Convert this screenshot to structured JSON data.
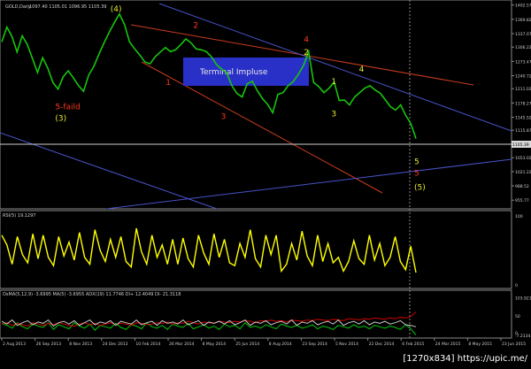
{
  "header": {
    "symbol_label": "GOLD,Daily",
    "ohlc": "1097.40 1105.01 1096.95 1105.39"
  },
  "watermark": "[1270x834] https://upic.me/",
  "chart_data": [
    {
      "type": "line",
      "title": "GOLD,Daily",
      "x": [
        "2 Aug 2013",
        "26 Sep 2013",
        "8 Nov 2013",
        "24 Dec 2013",
        "10 Feb 2014",
        "26 Mar 2014",
        "8 May 2014",
        "25 Jun 2014",
        "8 Aug 2014",
        "23 Sep 2014",
        "5 Nov 2014",
        "22 Dec 2014",
        "6 Feb 2015",
        "24 Mar 2015",
        "8 May 2015",
        "23 Jun 2015"
      ],
      "yticks": [
        1402.57,
        1369.82,
        1337.07,
        1306.22,
        1273.47,
        1240.72,
        1211.02,
        1178.27,
        1145.52,
        1115.87,
        1083.12,
        1053.02,
        1021.22,
        988.52,
        955.77
      ],
      "ylim": [
        940,
        1410
      ],
      "current_price": 1105.39,
      "current_price_label": "1105.39",
      "series": [
        {
          "color": "#16c60c",
          "values": [
            1318,
            1352,
            1330,
            1295,
            1332,
            1312,
            1280,
            1248,
            1282,
            1258,
            1225,
            1210,
            1238,
            1252,
            1236,
            1218,
            1205,
            1242,
            1262,
            1290,
            1316,
            1340,
            1362,
            1382,
            1358,
            1318,
            1302,
            1288,
            1272,
            1268,
            1284,
            1295,
            1305,
            1296,
            1300,
            1312,
            1325,
            1316,
            1302,
            1300,
            1296,
            1284,
            1266,
            1256,
            1247,
            1218,
            1200,
            1192,
            1222,
            1228,
            1206,
            1188,
            1175,
            1156,
            1198,
            1202,
            1218,
            1227,
            1244,
            1264,
            1296,
            1225,
            1216,
            1202,
            1212,
            1226,
            1184,
            1185,
            1174,
            1192,
            1202,
            1212,
            1218,
            1208,
            1201,
            1186,
            1170,
            1162,
            1174,
            1150,
            1131,
            1097
          ]
        }
      ],
      "wave_labels": [
        {
          "text": "(4)",
          "x": "10 Feb 2014",
          "y": 1388,
          "color": "#e8e830"
        },
        {
          "text": "2",
          "x": "25 Jun 2014",
          "y": 1350,
          "color": "#ff3a1a"
        },
        {
          "text": "4",
          "x": "22 Dec 2014",
          "y": 1318,
          "color": "#ff3a1a"
        },
        {
          "text": "2",
          "x": "22 Dec 2014",
          "y": 1288,
          "color": "#e8e830"
        },
        {
          "text": "1",
          "x": "8 May 2014",
          "y": 1220,
          "color": "#ff3a1a"
        },
        {
          "text": "1",
          "x": "6 Feb 2015",
          "y": 1222,
          "color": "#e8e830"
        },
        {
          "text": "4",
          "x": "24 Mar 2015",
          "y": 1250,
          "color": "#e8e830"
        },
        {
          "text": "3",
          "x": "8 Aug 2014",
          "y": 1142,
          "color": "#ff3a1a"
        },
        {
          "text": "3",
          "x": "6 Feb 2015",
          "y": 1148,
          "color": "#e8e830"
        },
        {
          "text": "5-faild",
          "x": "8 Nov 2013",
          "y": 1164,
          "color": "#ff3a1a"
        },
        {
          "text": "(3)",
          "x": "8 Nov 2013",
          "y": 1138,
          "color": "#e8e830"
        },
        {
          "text": "5",
          "x": "23 Jun 2015",
          "y": 1038,
          "color": "#e8e830"
        },
        {
          "text": "5",
          "x": "23 Jun 2015",
          "y": 1012,
          "color": "#ff3a1a"
        },
        {
          "text": "(5)",
          "x": "23 Jun 2015",
          "y": 980,
          "color": "#e8e830"
        }
      ],
      "annotation": {
        "text": "Terminal Impluse",
        "color": "#2930c8"
      }
    },
    {
      "type": "line",
      "title": "RSI(5) 19.1297",
      "ylim": [
        0,
        100
      ],
      "yticks": [
        100,
        0
      ],
      "series": [
        {
          "color": "#ffff00",
          "values": [
            72,
            58,
            30,
            70,
            44,
            32,
            74,
            38,
            72,
            40,
            28,
            70,
            42,
            62,
            36,
            76,
            40,
            30,
            80,
            50,
            34,
            66,
            40,
            70,
            34,
            26,
            82,
            48,
            30,
            72,
            40,
            58,
            30,
            66,
            30,
            68,
            38,
            26,
            72,
            46,
            30,
            74,
            40,
            66,
            32,
            28,
            60,
            40,
            80,
            38,
            26,
            72,
            44,
            72,
            20,
            30,
            60,
            36,
            78,
            42,
            28,
            72,
            34,
            60,
            32,
            40,
            20,
            34,
            64,
            38,
            30,
            72,
            36,
            60,
            28,
            40,
            70,
            34,
            22,
            56,
            18
          ]
        }
      ]
    },
    {
      "type": "line",
      "title": "OsMA(5,12,9) -3.6995 MA(5) -3.6955 ADX(19) 11.7746 DI+ 12.4049 DI- 21.3118",
      "ylim": [
        -10,
        110
      ],
      "yticks": [
        103.9213,
        50,
        0,
        -7.2134
      ],
      "series": [
        {
          "color": "#00c800",
          "values": [
            28,
            22,
            14,
            30,
            18,
            12,
            26,
            20,
            16,
            30,
            10,
            24,
            18,
            12,
            30,
            20,
            14,
            26,
            8,
            22,
            18,
            14,
            28,
            16,
            10,
            24,
            20,
            12,
            30,
            18,
            14,
            22,
            10,
            26,
            20,
            16,
            28,
            12,
            18,
            24,
            14,
            20,
            10,
            26,
            18,
            22,
            12,
            30,
            16,
            20,
            14,
            24,
            18,
            12,
            26,
            20,
            16,
            22,
            14,
            18,
            24,
            12,
            20,
            16,
            10,
            22,
            18,
            14,
            24,
            16,
            20,
            12,
            22,
            18,
            14,
            20,
            16,
            10,
            24,
            12,
            -6
          ]
        },
        {
          "color": "#d40000",
          "values": [
            26,
            30,
            22,
            28,
            24,
            20,
            30,
            26,
            22,
            28,
            24,
            30,
            26,
            22,
            20,
            26,
            30,
            24,
            28,
            22,
            26,
            30,
            24,
            28,
            26,
            22,
            30,
            28,
            24,
            26,
            30,
            28,
            32,
            26,
            30,
            28,
            34,
            30,
            26,
            32,
            30,
            28,
            34,
            32,
            30,
            34,
            32,
            36,
            34,
            30,
            36,
            34,
            38,
            34,
            36,
            32,
            38,
            36,
            34,
            38,
            36,
            40,
            38,
            36,
            40,
            38,
            36,
            42,
            40,
            38,
            42,
            40,
            44,
            42,
            40,
            44,
            42,
            46,
            44,
            48,
            62
          ]
        },
        {
          "color": "#c8c8c8",
          "values": [
            34,
            26,
            38,
            22,
            30,
            36,
            24,
            32,
            28,
            38,
            20,
            30,
            34,
            26,
            36,
            22,
            30,
            38,
            24,
            32,
            28,
            36,
            22,
            34,
            30,
            26,
            38,
            24,
            30,
            34,
            22,
            36,
            28,
            32,
            26,
            38,
            24,
            30,
            36,
            22,
            32,
            28,
            34,
            26,
            36,
            24,
            30,
            38,
            22,
            32,
            28,
            36,
            24,
            30,
            34,
            26,
            38,
            22,
            32,
            28,
            36,
            24,
            30,
            34,
            26,
            38,
            22,
            30,
            34,
            26,
            36,
            24,
            32,
            28,
            34,
            26,
            30,
            36,
            24,
            22,
            18
          ]
        }
      ]
    }
  ]
}
